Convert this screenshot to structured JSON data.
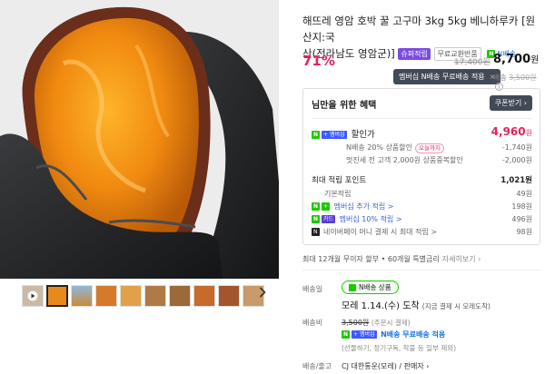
{
  "product": {
    "title": "해뜨레 영암 호박 꿀 고구마 3kg 5kg 베니하루카 [원산지:국산(전라남도 영암군)]",
    "title_line1": "해뜨레 영암 호박 꿀 고구마 3kg 5kg 베니하루카 [원산지:국",
    "title_line2": "산(전라남도 영암군)]",
    "tag_membership": "슈퍼적립",
    "tag_free_return": "무료교환반품",
    "tag_npay": "N배송"
  },
  "pricing": {
    "discount": "71%",
    "original": "17,400원",
    "price": "8,700",
    "price_unit": "원",
    "membership_pill": "멤버십 N배송 무료배송 적용",
    "pill_close": "×",
    "ship_label": "배송",
    "ship_cost": "3,500원"
  },
  "benefit": {
    "heading": "님만을 위한 혜택",
    "coupon_button": "쿠폰받기",
    "coupon_chevron": "›",
    "discount_label": "할인가",
    "discount_price": "4,960",
    "discount_unit": "원",
    "rows": [
      {
        "label": "N배송 20% 상품할인",
        "tag": "오늘까지",
        "value": "-1,740원"
      },
      {
        "label": "멋진세 전 고객 2,000원 상품중복할인",
        "value": "-2,000원"
      }
    ],
    "points_label": "최대 적립 포인트",
    "points_value": "1,021원",
    "point_rows": [
      {
        "label": "기본적립",
        "value": "49원"
      },
      {
        "label": "멤버십 추가 적립 >",
        "value": "198원"
      },
      {
        "label": "멤버십 10% 적립 >",
        "value": "496원"
      },
      {
        "label": "네이버페이 머니 결제 시 최대 적립 >",
        "value": "98원"
      }
    ]
  },
  "installment": {
    "text": "최대 12개월 무이자 할부 • 60개월 특별금리",
    "more": "자세히보기 ›"
  },
  "delivery": {
    "label": "배송일",
    "pill": "N배송 상품",
    "arrival": "모레 1.14.(수) 도착",
    "arrival_note": "(지금 결제 시 모레도착)"
  },
  "shipping": {
    "label": "배송비",
    "cost": "3,500원",
    "cost_note": "(주문시 결제)",
    "free_text": "N배송 무료배송 적용",
    "sub": "(선물하기, 정기구독, 착불 등 일부 제외)"
  },
  "carrier": {
    "label": "배송/출고",
    "value": "CJ 대한통운(모레) / 판매자 ›"
  },
  "colors": {
    "accent_red": "#e0245e",
    "naver_green": "#1ec800",
    "dark_pill": "#434a57"
  },
  "icons": [
    "play-icon",
    "chevron-right-icon",
    "close-icon",
    "info-icon",
    "naver-n-icon"
  ]
}
